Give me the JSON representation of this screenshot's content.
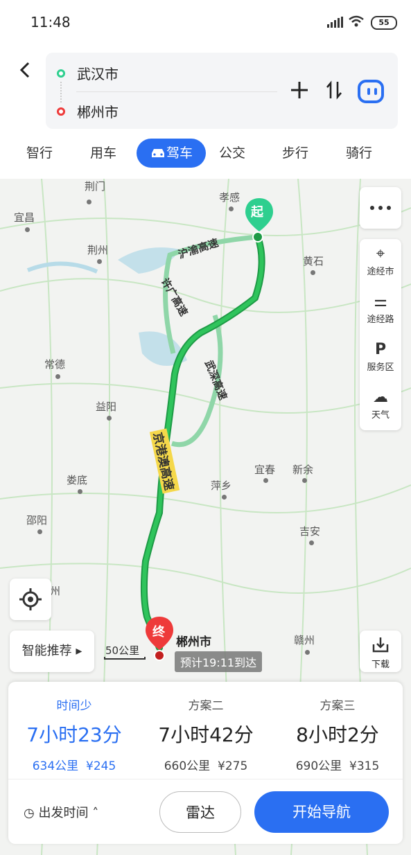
{
  "status": {
    "time": "11:48",
    "battery": "55"
  },
  "route": {
    "origin": "武汉市",
    "destination": "郴州市"
  },
  "modes": [
    "智行",
    "用车",
    "驾车",
    "公交",
    "步行",
    "骑行"
  ],
  "active_mode": "驾车",
  "map": {
    "places": [
      "荆门",
      "孝感",
      "宜昌",
      "荆州",
      "黄石",
      "常德",
      "益阳",
      "娄底",
      "邵阳",
      "萍乡",
      "宜春",
      "新余",
      "吉安",
      "赣州",
      "州"
    ],
    "highways": [
      "沪渝高速",
      "许广高速",
      "武深高速",
      "京港澳高速"
    ],
    "start_marker": "起",
    "end_marker": "终",
    "end_label": "郴州市",
    "eta": "预计19:11到达",
    "scale": "50公里"
  },
  "side_tools": [
    {
      "label": "途经市",
      "icon": "waypoint-city-icon"
    },
    {
      "label": "途经路",
      "icon": "waypoint-road-icon"
    },
    {
      "label": "服务区",
      "icon": "service-area-icon"
    },
    {
      "label": "天气",
      "icon": "weather-icon"
    }
  ],
  "smart_recommend": "智能推荐",
  "download": "下载",
  "plans": [
    {
      "name": "时间少",
      "time": "7小时23分",
      "distance": "634公里",
      "toll": "¥245"
    },
    {
      "name": "方案二",
      "time": "7小时42分",
      "distance": "660公里",
      "toll": "¥275"
    },
    {
      "name": "方案三",
      "time": "8小时2分",
      "distance": "690公里",
      "toll": "¥315"
    }
  ],
  "depart_label": "出发时间",
  "radar_label": "雷达",
  "nav_label": "开始导航",
  "colors": {
    "accent": "#2a6ff2",
    "route": "#22b14c",
    "start": "#2ecf8f",
    "end": "#ee3a3a"
  }
}
